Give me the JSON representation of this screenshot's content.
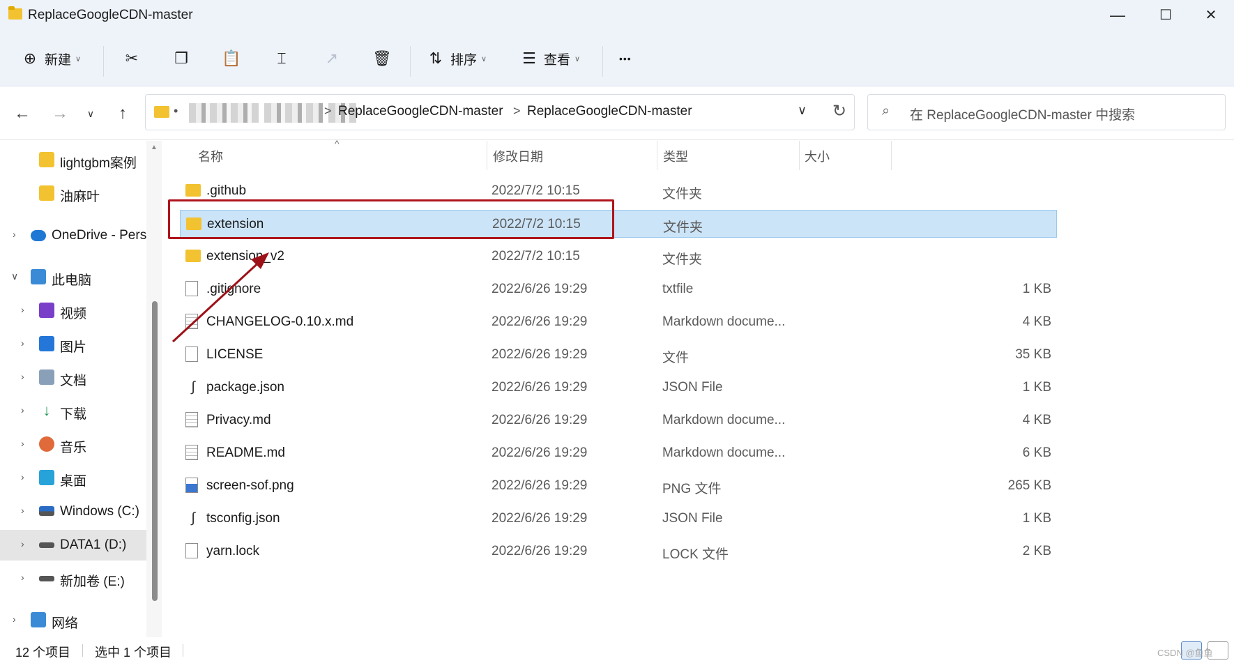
{
  "window": {
    "title": "ReplaceGoogleCDN-master",
    "minimize_glyph": "—",
    "maximize_glyph": "☐",
    "close_glyph": "✕"
  },
  "toolbar": {
    "new_label": "新建",
    "sort_label": "排序",
    "view_label": "查看",
    "more_glyph": "•••"
  },
  "address": {
    "crumbs": [
      "ReplaceGoogleCDN-master",
      "ReplaceGoogleCDN-master"
    ],
    "separator": ">"
  },
  "search": {
    "placeholder": "在 ReplaceGoogleCDN-master 中搜索"
  },
  "sidebar": {
    "items": [
      {
        "label": "lightgbm案例"
      },
      {
        "label": "油麻叶"
      },
      {
        "label": "OneDrive - Pers"
      },
      {
        "label": "此电脑"
      },
      {
        "label": "视频"
      },
      {
        "label": "图片"
      },
      {
        "label": "文档"
      },
      {
        "label": "下载"
      },
      {
        "label": "音乐"
      },
      {
        "label": "桌面"
      },
      {
        "label": "Windows (C:)"
      },
      {
        "label": "DATA1 (D:)"
      },
      {
        "label": "新加卷 (E:)"
      },
      {
        "label": "网络"
      }
    ]
  },
  "columns": {
    "name": "名称",
    "modified": "修改日期",
    "type": "类型",
    "size": "大小"
  },
  "files": [
    {
      "name": ".github",
      "date": "2022/7/2 10:15",
      "type": "文件夹",
      "size": "",
      "icon": "folder-icon"
    },
    {
      "name": "extension",
      "date": "2022/7/2 10:15",
      "type": "文件夹",
      "size": "",
      "icon": "folder-icon"
    },
    {
      "name": "extension_v2",
      "date": "2022/7/2 10:15",
      "type": "文件夹",
      "size": "",
      "icon": "folder-icon"
    },
    {
      "name": ".gitignore",
      "date": "2022/6/26 19:29",
      "type": "txtfile",
      "size": "1 KB",
      "icon": "file-icon"
    },
    {
      "name": "CHANGELOG-0.10.x.md",
      "date": "2022/6/26 19:29",
      "type": "Markdown docume...",
      "size": "4 KB",
      "icon": "markdown-file-icon"
    },
    {
      "name": "LICENSE",
      "date": "2022/6/26 19:29",
      "type": "文件",
      "size": "35 KB",
      "icon": "file-icon"
    },
    {
      "name": "package.json",
      "date": "2022/6/26 19:29",
      "type": "JSON File",
      "size": "1 KB",
      "icon": "json-file-icon"
    },
    {
      "name": "Privacy.md",
      "date": "2022/6/26 19:29",
      "type": "Markdown docume...",
      "size": "4 KB",
      "icon": "markdown-file-icon"
    },
    {
      "name": "README.md",
      "date": "2022/6/26 19:29",
      "type": "Markdown docume...",
      "size": "6 KB",
      "icon": "markdown-file-icon"
    },
    {
      "name": "screen-sof.png",
      "date": "2022/6/26 19:29",
      "type": "PNG 文件",
      "size": "265 KB",
      "icon": "png-file-icon"
    },
    {
      "name": "tsconfig.json",
      "date": "2022/6/26 19:29",
      "type": "JSON File",
      "size": "1 KB",
      "icon": "json-file-icon"
    },
    {
      "name": "yarn.lock",
      "date": "2022/6/26 19:29",
      "type": "LOCK 文件",
      "size": "2 KB",
      "icon": "file-icon"
    }
  ],
  "status": {
    "count": "12 个项目",
    "selected": "选中 1 个项目"
  },
  "watermark": "CSDN @鱼鱼",
  "colors": {
    "selection": "#cce4f7",
    "annotation": "#b0141c",
    "folder": "#f2c230",
    "titlebar": "#eef3fa"
  }
}
